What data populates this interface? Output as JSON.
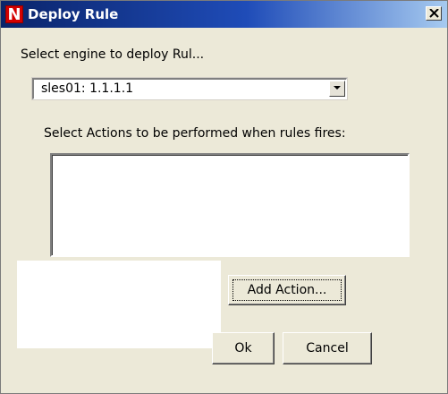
{
  "window": {
    "title": "Deploy Rule",
    "app_icon_letter": "N",
    "close_label": "close"
  },
  "engine": {
    "label": "Select engine to deploy Rul...",
    "selected": "sles01: 1.1.1.1"
  },
  "actions": {
    "label": "Select Actions to be performed when rules fires:",
    "items": []
  },
  "buttons": {
    "add_action": "Add Action...",
    "ok": "Ok",
    "cancel": "Cancel"
  },
  "colors": {
    "titlebar_start": "#0a246a",
    "titlebar_end": "#a6caf0",
    "app_icon": "#d40000",
    "dialog_bg": "#ece9d8"
  },
  "icons": {
    "app": "novell-n-icon",
    "close": "close-icon",
    "dropdown": "chevron-down-icon"
  }
}
